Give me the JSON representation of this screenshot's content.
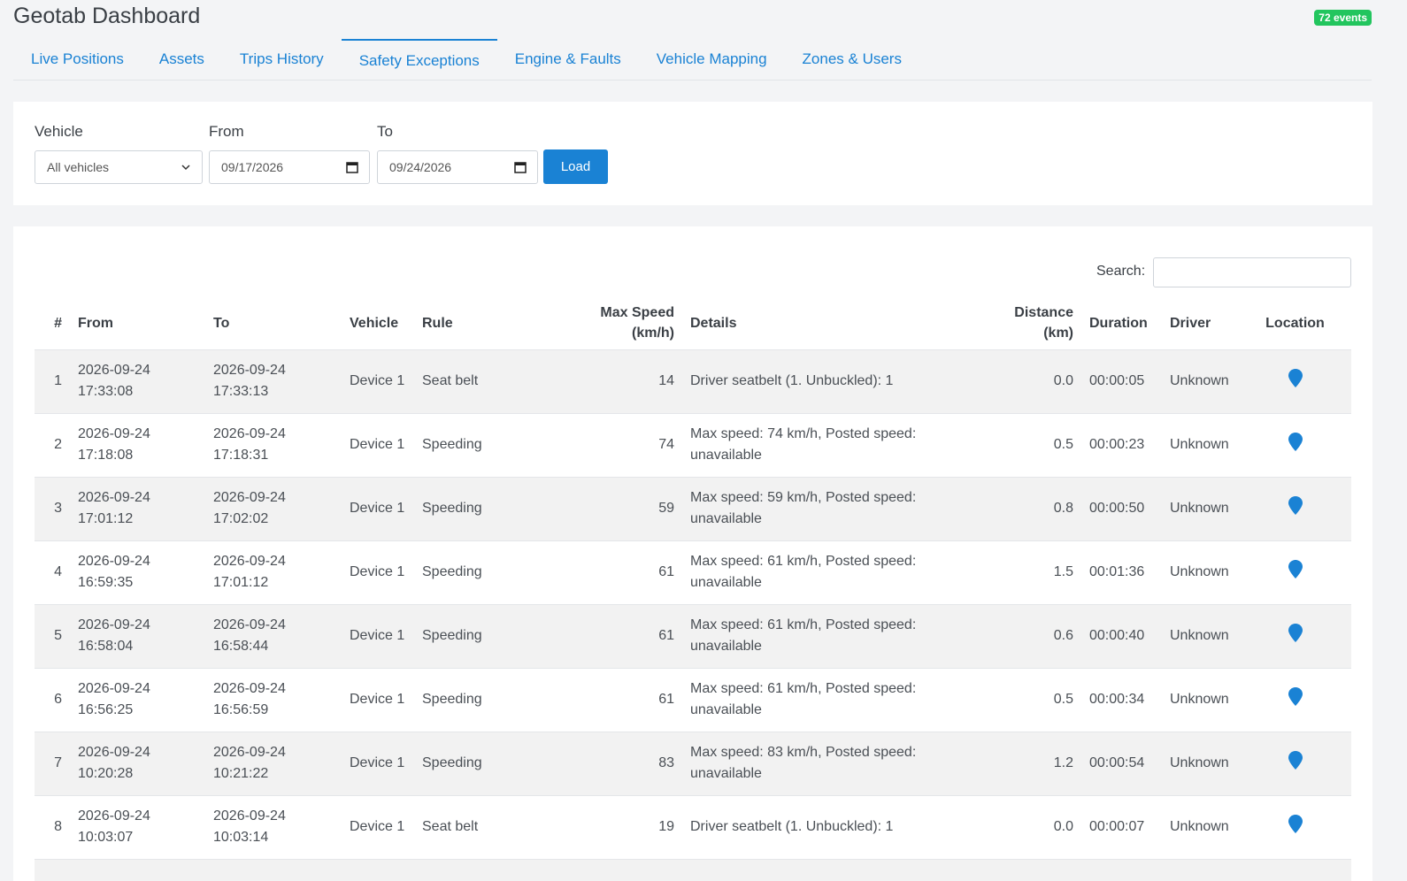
{
  "app": {
    "title": "Geotab Dashboard",
    "events_badge": "72 events"
  },
  "tabs": [
    {
      "label": "Live Positions"
    },
    {
      "label": "Assets"
    },
    {
      "label": "Trips History"
    },
    {
      "label": "Safety Exceptions",
      "active": true
    },
    {
      "label": "Engine & Faults"
    },
    {
      "label": "Vehicle Mapping"
    },
    {
      "label": "Zones & Users"
    }
  ],
  "filters": {
    "vehicle_label": "Vehicle",
    "vehicle_value": "All vehicles",
    "from_label": "From",
    "from_value": "09/17/2026",
    "to_label": "To",
    "to_value": "09/24/2026",
    "load_label": "Load"
  },
  "search": {
    "label": "Search:",
    "value": ""
  },
  "table": {
    "headers": {
      "num": "#",
      "from": "From",
      "to": "To",
      "vehicle": "Vehicle",
      "rule": "Rule",
      "max_speed_1": "Max Speed",
      "max_speed_2": "(km/h)",
      "details": "Details",
      "distance_1": "Distance",
      "distance_2": "(km)",
      "duration": "Duration",
      "driver": "Driver",
      "location": "Location"
    },
    "rows": [
      {
        "num": "1",
        "from_date": "2026-09-24",
        "from_time": "17:33:08",
        "to_date": "2026-09-24",
        "to_time": "17:33:13",
        "vehicle": "Device 1",
        "rule": "Seat belt",
        "max_speed": "14",
        "details_1": "Driver seatbelt (1. Unbuckled): 1",
        "details_2": "",
        "distance": "0.0",
        "duration": "00:00:05",
        "driver": "Unknown"
      },
      {
        "num": "2",
        "from_date": "2026-09-24",
        "from_time": "17:18:08",
        "to_date": "2026-09-24",
        "to_time": "17:18:31",
        "vehicle": "Device 1",
        "rule": "Speeding",
        "max_speed": "74",
        "details_1": "Max speed: 74 km/h, Posted speed:",
        "details_2": "unavailable",
        "distance": "0.5",
        "duration": "00:00:23",
        "driver": "Unknown"
      },
      {
        "num": "3",
        "from_date": "2026-09-24",
        "from_time": "17:01:12",
        "to_date": "2026-09-24",
        "to_time": "17:02:02",
        "vehicle": "Device 1",
        "rule": "Speeding",
        "max_speed": "59",
        "details_1": "Max speed: 59 km/h, Posted speed:",
        "details_2": "unavailable",
        "distance": "0.8",
        "duration": "00:00:50",
        "driver": "Unknown"
      },
      {
        "num": "4",
        "from_date": "2026-09-24",
        "from_time": "16:59:35",
        "to_date": "2026-09-24",
        "to_time": "17:01:12",
        "vehicle": "Device 1",
        "rule": "Speeding",
        "max_speed": "61",
        "details_1": "Max speed: 61 km/h, Posted speed:",
        "details_2": "unavailable",
        "distance": "1.5",
        "duration": "00:01:36",
        "driver": "Unknown"
      },
      {
        "num": "5",
        "from_date": "2026-09-24",
        "from_time": "16:58:04",
        "to_date": "2026-09-24",
        "to_time": "16:58:44",
        "vehicle": "Device 1",
        "rule": "Speeding",
        "max_speed": "61",
        "details_1": "Max speed: 61 km/h, Posted speed:",
        "details_2": "unavailable",
        "distance": "0.6",
        "duration": "00:00:40",
        "driver": "Unknown"
      },
      {
        "num": "6",
        "from_date": "2026-09-24",
        "from_time": "16:56:25",
        "to_date": "2026-09-24",
        "to_time": "16:56:59",
        "vehicle": "Device 1",
        "rule": "Speeding",
        "max_speed": "61",
        "details_1": "Max speed: 61 km/h, Posted speed:",
        "details_2": "unavailable",
        "distance": "0.5",
        "duration": "00:00:34",
        "driver": "Unknown"
      },
      {
        "num": "7",
        "from_date": "2026-09-24",
        "from_time": "10:20:28",
        "to_date": "2026-09-24",
        "to_time": "10:21:22",
        "vehicle": "Device 1",
        "rule": "Speeding",
        "max_speed": "83",
        "details_1": "Max speed: 83 km/h, Posted speed:",
        "details_2": "unavailable",
        "distance": "1.2",
        "duration": "00:00:54",
        "driver": "Unknown"
      },
      {
        "num": "8",
        "from_date": "2026-09-24",
        "from_time": "10:03:07",
        "to_date": "2026-09-24",
        "to_time": "10:03:14",
        "vehicle": "Device 1",
        "rule": "Seat belt",
        "max_speed": "19",
        "details_1": "Driver seatbelt (1. Unbuckled): 1",
        "details_2": "",
        "distance": "0.0",
        "duration": "00:00:07",
        "driver": "Unknown"
      }
    ]
  },
  "colors": {
    "accent": "#1a82d4",
    "badge": "#22c55e",
    "pin": "#1a82d4",
    "row_stripe": "#f2f2f2"
  },
  "icons": {
    "location": "map-pin-icon",
    "calendar": "calendar-icon",
    "dropdown": "chevron-down-icon"
  }
}
